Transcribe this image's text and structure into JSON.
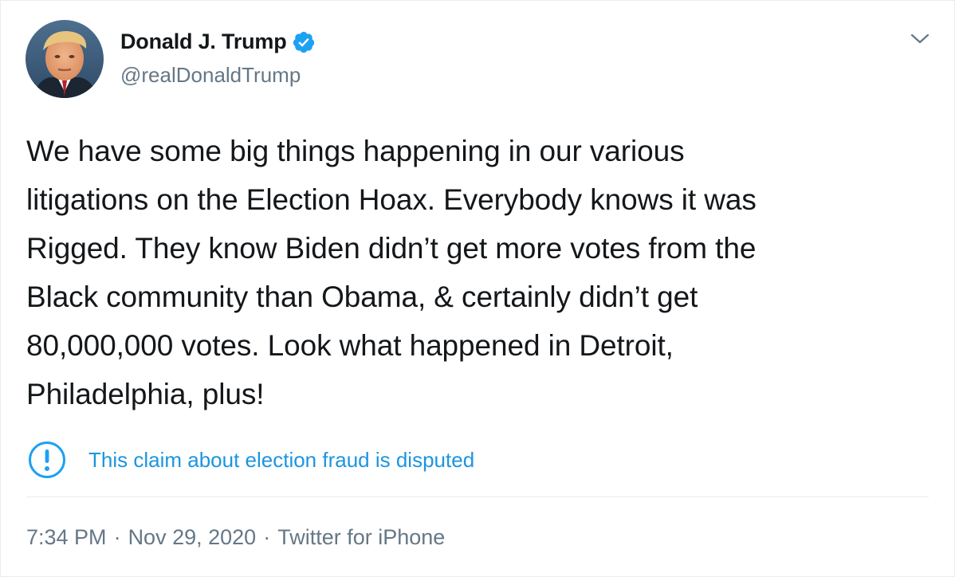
{
  "author": {
    "name": "Donald J. Trump",
    "handle": "@realDonaldTrump",
    "verified_icon": "verified-badge-icon"
  },
  "tweet": {
    "text": "We have some big things happening in our various\nlitigations on the Election Hoax. Everybody knows it was\nRigged. They know Biden didn’t get more votes from the\nBlack community than Obama, & certainly didn’t get\n80,000,000 votes. Look what happened in Detroit,\nPhiladelphia, plus!"
  },
  "notice": {
    "icon": "exclamation-circle-icon",
    "text": "This claim about election fraud is disputed"
  },
  "meta": {
    "time": "7:34 PM",
    "separator": "·",
    "date": "Nov 29, 2020",
    "source": "Twitter for iPhone"
  },
  "colors": {
    "accent": "#1da1f2",
    "link": "#1b95e0",
    "secondary_text": "#657786",
    "divider": "#e6ecf0"
  }
}
